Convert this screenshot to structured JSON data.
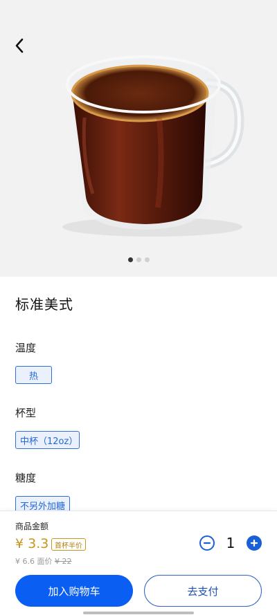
{
  "product": {
    "name": "标准美式",
    "image_icon": "americano-glass-mug-icon"
  },
  "carousel": {
    "total": 3,
    "active": 1
  },
  "options": [
    {
      "label": "温度",
      "selected": "热"
    },
    {
      "label": "杯型",
      "selected": "中杯（12oz）"
    },
    {
      "label": "糖度",
      "selected": "不另外加糖"
    }
  ],
  "checkout": {
    "amount_label": "商品金额",
    "price": "¥ 3.3",
    "promo": "首杯半价",
    "orig_prefix": "¥ 6.6 面价",
    "orig_price": "¥ 22",
    "quantity": "1",
    "add_to_cart": "加入购物车",
    "pay": "去支付"
  },
  "colors": {
    "primary_blue": "#0b5ef2",
    "price_gold": "#c4961a",
    "chip_bg": "#eaf1fd"
  }
}
